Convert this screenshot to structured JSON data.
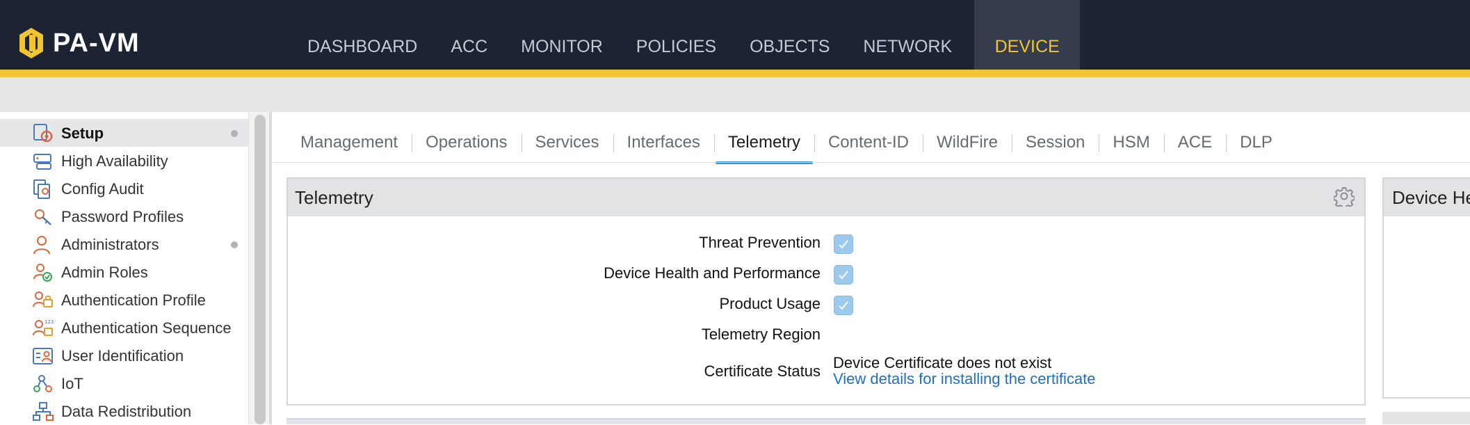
{
  "app": {
    "logo_text": "PA-VM"
  },
  "nav": {
    "items": [
      {
        "label": "DASHBOARD"
      },
      {
        "label": "ACC"
      },
      {
        "label": "MONITOR"
      },
      {
        "label": "POLICIES"
      },
      {
        "label": "OBJECTS"
      },
      {
        "label": "NETWORK"
      },
      {
        "label": "DEVICE",
        "active": true
      }
    ]
  },
  "sidebar": {
    "items": [
      {
        "label": "Setup",
        "icon": "setup-gear-icon",
        "active": true,
        "dot": true
      },
      {
        "label": "High Availability",
        "icon": "high-availability-icon"
      },
      {
        "label": "Config Audit",
        "icon": "config-audit-icon"
      },
      {
        "label": "Password Profiles",
        "icon": "password-profiles-icon"
      },
      {
        "label": "Administrators",
        "icon": "administrator-user-icon",
        "dot": true
      },
      {
        "label": "Admin Roles",
        "icon": "admin-roles-icon"
      },
      {
        "label": "Authentication Profile",
        "icon": "authentication-profile-icon"
      },
      {
        "label": "Authentication Sequence",
        "icon": "authentication-sequence-icon"
      },
      {
        "label": "User Identification",
        "icon": "user-identification-icon"
      },
      {
        "label": "IoT",
        "icon": "iot-icon"
      },
      {
        "label": "Data Redistribution",
        "icon": "data-redistribution-icon"
      }
    ]
  },
  "tabs": [
    {
      "label": "Management"
    },
    {
      "label": "Operations"
    },
    {
      "label": "Services"
    },
    {
      "label": "Interfaces"
    },
    {
      "label": "Telemetry",
      "active": true
    },
    {
      "label": "Content-ID"
    },
    {
      "label": "WildFire"
    },
    {
      "label": "Session"
    },
    {
      "label": "HSM"
    },
    {
      "label": "ACE"
    },
    {
      "label": "DLP"
    }
  ],
  "telemetry_panel": {
    "title": "Telemetry",
    "threat_prevention_label": "Threat Prevention",
    "threat_prevention_checked": true,
    "device_health_label": "Device Health and Performance",
    "device_health_checked": true,
    "product_usage_label": "Product Usage",
    "product_usage_checked": true,
    "region_label": "Telemetry Region",
    "region_value": "",
    "cert_status_label": "Certificate Status",
    "cert_status_value": "Device Certificate does not exist",
    "cert_link": "View details for installing the certificate"
  },
  "side_panel": {
    "title": "Device He"
  },
  "colors": {
    "topbar": "#1c2433",
    "accent_yellow": "#f0c433",
    "tab_underline": "#3a8bd1",
    "link": "#1f6fc4",
    "checkbox": "#9cc9ee"
  }
}
